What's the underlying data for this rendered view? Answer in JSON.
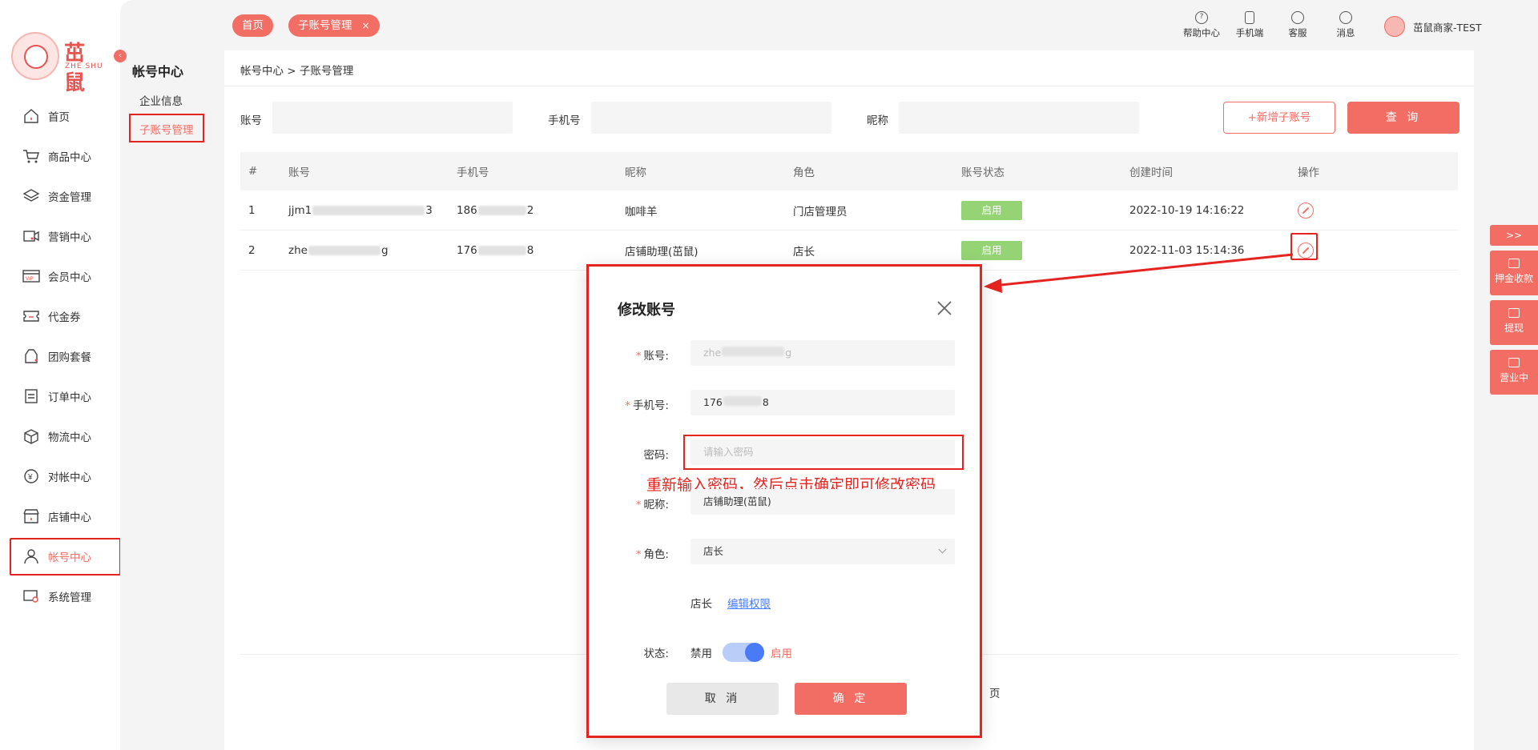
{
  "logo": {
    "text": "茁鼠",
    "sub": "ZHE SHU"
  },
  "nav": [
    {
      "label": "首页",
      "icon": "home-icon"
    },
    {
      "label": "商品中心",
      "icon": "cart-icon"
    },
    {
      "label": "资金管理",
      "icon": "layers-icon"
    },
    {
      "label": "营销中心",
      "icon": "video-icon"
    },
    {
      "label": "会员中心",
      "icon": "vip-icon"
    },
    {
      "label": "代金券",
      "icon": "coupon-icon"
    },
    {
      "label": "团购套餐",
      "icon": "bag-icon"
    },
    {
      "label": "订单中心",
      "icon": "order-icon"
    },
    {
      "label": "物流中心",
      "icon": "box-icon"
    },
    {
      "label": "对帐中心",
      "icon": "yen-icon"
    },
    {
      "label": "店铺中心",
      "icon": "store-icon"
    },
    {
      "label": "帐号中心",
      "icon": "user-icon"
    },
    {
      "label": "系统管理",
      "icon": "settings-icon"
    }
  ],
  "subnav": {
    "title": "帐号中心",
    "items": [
      "企业信息",
      "子账号管理"
    ]
  },
  "tabs": {
    "home": "首页",
    "current": "子账号管理",
    "close": "×"
  },
  "tools": {
    "help": "帮助中心",
    "mobile": "手机端",
    "service": "客服",
    "messages": "消息"
  },
  "user": {
    "name": "茁鼠商家-TEST"
  },
  "breadcrumb": "帐号中心  > 子账号管理",
  "filters": {
    "account": "账号",
    "phone": "手机号",
    "nickname": "昵称",
    "add_btn": "+新增子账号",
    "query_btn": "查 询"
  },
  "table": {
    "headers": [
      "#",
      "账号",
      "手机号",
      "昵称",
      "角色",
      "账号状态",
      "创建时间",
      "操作"
    ],
    "rows": [
      {
        "no": "1",
        "acc_a": "jjm1",
        "acc_b": "3",
        "ph_a": "186",
        "ph_b": "2",
        "nick": "咖啡羊",
        "role": "门店管理员",
        "status": "启用",
        "created": "2022-10-19 14:16:22"
      },
      {
        "no": "2",
        "acc_a": "zhe",
        "acc_b": "g",
        "ph_a": "176",
        "ph_b": "8",
        "nick": "店铺助理(茁鼠)",
        "role": "店长",
        "status": "启用",
        "created": "2022-11-03 15:14:36"
      }
    ]
  },
  "pagination": {
    "page_suffix": "页"
  },
  "floats": {
    "expand": ">>",
    "deposit": "押金收款",
    "withdraw": "提现",
    "open": "营业中"
  },
  "modal": {
    "title": "修改账号",
    "account_label": "账号:",
    "account_a": "zhe",
    "account_b": "g",
    "phone_label": "手机号:",
    "phone_a": "176",
    "phone_b": "8",
    "password_label": "密码:",
    "password_placeholder": "请输入密码",
    "hint": "重新输入密码，然后点击确定即可修改密码",
    "nickname_label": "昵称:",
    "nickname_value": "店铺助理(茁鼠)",
    "role_label": "角色:",
    "role_value": "店长",
    "perm_role": "店长",
    "perm_link": "编辑权限",
    "status_label": "状态:",
    "status_off": "禁用",
    "status_on": "启用",
    "cancel": "取 消",
    "ok": "确 定"
  },
  "colors": {
    "accent": "#f26d64",
    "annotation": "#e52420",
    "status_green": "#95d475",
    "link": "#4a7bf7"
  }
}
